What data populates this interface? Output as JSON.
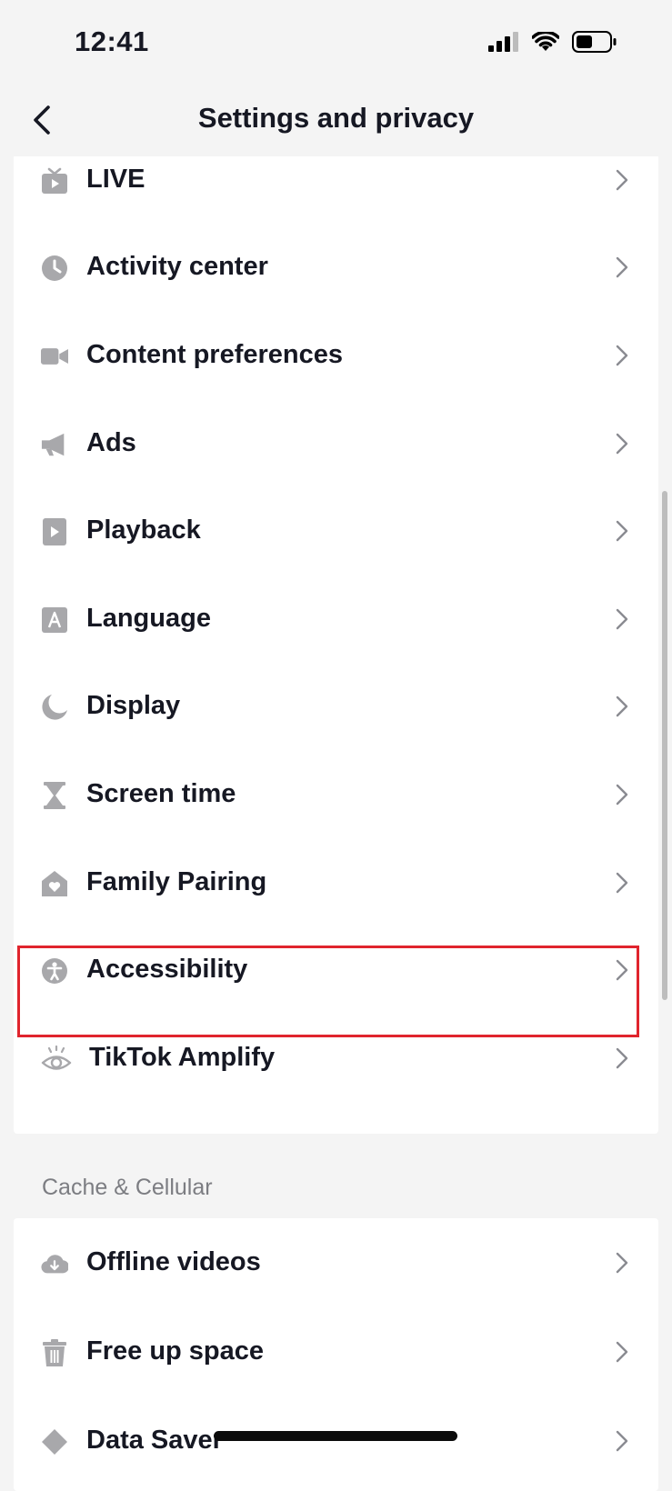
{
  "status": {
    "time": "12:41"
  },
  "header": {
    "title": "Settings and privacy"
  },
  "section1": {
    "items": [
      {
        "label": "LIVE",
        "icon": "live-tv-icon"
      },
      {
        "label": "Activity center",
        "icon": "clock-icon"
      },
      {
        "label": "Content preferences",
        "icon": "video-camera-icon"
      },
      {
        "label": "Ads",
        "icon": "megaphone-icon"
      },
      {
        "label": "Playback",
        "icon": "play-icon"
      },
      {
        "label": "Language",
        "icon": "language-icon"
      },
      {
        "label": "Display",
        "icon": "moon-icon"
      },
      {
        "label": "Screen time",
        "icon": "hourglass-icon"
      },
      {
        "label": "Family Pairing",
        "icon": "home-heart-icon"
      },
      {
        "label": "Accessibility",
        "icon": "accessibility-icon",
        "highlighted": true
      },
      {
        "label": "TikTok Amplify",
        "icon": "eye-icon"
      }
    ]
  },
  "section2": {
    "title": "Cache & Cellular",
    "items": [
      {
        "label": "Offline videos",
        "icon": "cloud-download-icon"
      },
      {
        "label": "Free up space",
        "icon": "trash-icon"
      },
      {
        "label": "Data Saver",
        "icon": "data-saver-icon"
      }
    ]
  },
  "colors": {
    "background": "#f4f4f4",
    "card": "#ffffff",
    "text": "#161823",
    "icon_gray": "#a8a8ab",
    "highlight_border": "#e0242d"
  }
}
